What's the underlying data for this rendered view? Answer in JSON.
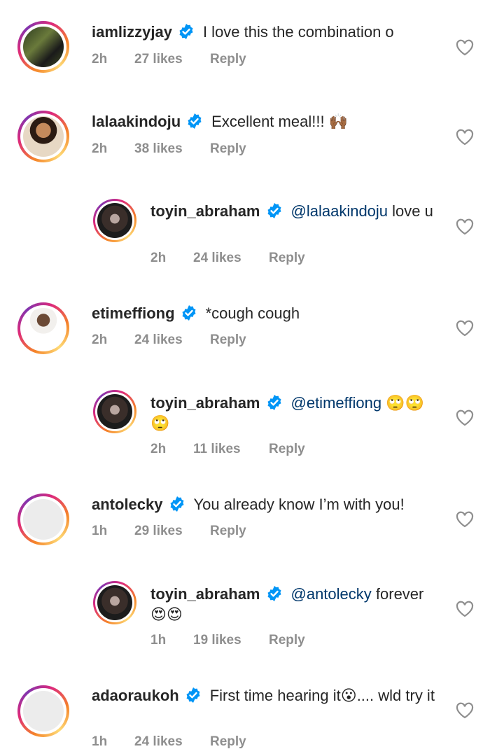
{
  "comments": [
    {
      "username": "iamlizzyjay",
      "text": "I love this the combination o",
      "time": "2h",
      "likes": "27 likes",
      "reply": "Reply"
    },
    {
      "username": "lalaakindoju",
      "text": "Excellent meal!!! 🙌🏾",
      "time": "2h",
      "likes": "38 likes",
      "reply": "Reply"
    },
    {
      "username": "toyin_abraham",
      "mention": "@lalaakindoju",
      "text": " love u",
      "time": "2h",
      "likes": "24 likes",
      "reply": "Reply"
    },
    {
      "username": "etimeffiong",
      "text": "*cough cough",
      "time": "2h",
      "likes": "24 likes",
      "reply": "Reply"
    },
    {
      "username": "toyin_abraham",
      "mention": "@etimeffiong",
      "text": " 🙄🙄🙄",
      "time": "2h",
      "likes": "11 likes",
      "reply": "Reply"
    },
    {
      "username": "antolecky",
      "text": "You already know I’m with you!",
      "time": "1h",
      "likes": "29 likes",
      "reply": "Reply"
    },
    {
      "username": "toyin_abraham",
      "mention": "@antolecky",
      "text": " forever 😍😍",
      "time": "1h",
      "likes": "19 likes",
      "reply": "Reply"
    },
    {
      "username": "adaoraukoh",
      "text": "First time hearing it😮.... wld try it",
      "time": "1h",
      "likes": "24 likes",
      "reply": "Reply"
    }
  ],
  "colors": {
    "text": "#262626",
    "secondary": "#8e8e8e",
    "mention": "#00376b",
    "verified": "#0095f6"
  },
  "icons": {
    "verified": "verified-badge-icon",
    "like": "heart-outline-icon"
  }
}
